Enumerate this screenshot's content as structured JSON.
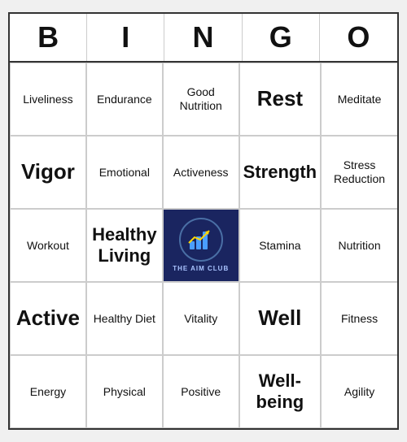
{
  "header": {
    "letters": [
      "B",
      "I",
      "N",
      "G",
      "O"
    ]
  },
  "cells": [
    {
      "text": "Liveliness",
      "size": "normal"
    },
    {
      "text": "Endurance",
      "size": "normal"
    },
    {
      "text": "Good Nutrition",
      "size": "normal"
    },
    {
      "text": "Rest",
      "size": "large"
    },
    {
      "text": "Meditate",
      "size": "normal"
    },
    {
      "text": "Vigor",
      "size": "large"
    },
    {
      "text": "Emotional",
      "size": "normal"
    },
    {
      "text": "Activeness",
      "size": "normal"
    },
    {
      "text": "Strength",
      "size": "medium-large"
    },
    {
      "text": "Stress Reduction",
      "size": "normal"
    },
    {
      "text": "Workout",
      "size": "normal"
    },
    {
      "text": "Healthy Living",
      "size": "medium-large"
    },
    {
      "text": "CENTER",
      "size": "center"
    },
    {
      "text": "Stamina",
      "size": "normal"
    },
    {
      "text": "Nutrition",
      "size": "normal"
    },
    {
      "text": "Active",
      "size": "large"
    },
    {
      "text": "Healthy Diet",
      "size": "normal"
    },
    {
      "text": "Vitality",
      "size": "normal"
    },
    {
      "text": "Well",
      "size": "large"
    },
    {
      "text": "Fitness",
      "size": "normal"
    },
    {
      "text": "Energy",
      "size": "normal"
    },
    {
      "text": "Physical",
      "size": "normal"
    },
    {
      "text": "Positive",
      "size": "normal"
    },
    {
      "text": "Well-being",
      "size": "medium-large"
    },
    {
      "text": "Agility",
      "size": "normal"
    }
  ],
  "logo": {
    "club_name": "THE AIM CLUB"
  }
}
